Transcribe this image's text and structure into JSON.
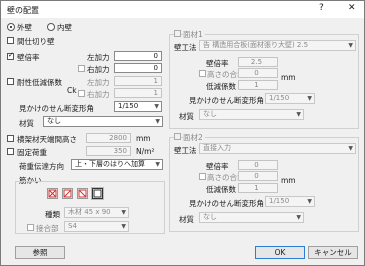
{
  "window": {
    "title": "壁の配置",
    "help": "?",
    "close": "✕"
  },
  "wall_side": {
    "outer": "外壁",
    "inner": "内壁",
    "selected": "outer"
  },
  "partition": {
    "label": "間仕切り壁",
    "checked": false
  },
  "wall_ratio": {
    "label": "壁倍率",
    "checked": true,
    "left_label": "左加力",
    "left_value": "0",
    "right_label": "右加力",
    "right_value": "0",
    "right_checked": false
  },
  "reduction": {
    "label": "耐性低減係数",
    "sub": "Ck",
    "checked": false,
    "left_label": "左加力",
    "left_value": "1",
    "right_label": "右加力",
    "right_value": "1",
    "right_checked": false
  },
  "apparent_shear": {
    "label": "見かけのせん断変形角",
    "value": "1/150"
  },
  "material": {
    "label": "材質",
    "value": "なし"
  },
  "ceiling_height": {
    "label": "横架材天端間高さ",
    "value": "2800",
    "unit": "mm",
    "checked": false
  },
  "fixed_load": {
    "label": "固定荷重",
    "value": "350",
    "unit": "N/m²",
    "checked": false
  },
  "load_direction": {
    "label": "荷重伝達方向",
    "value": "上・下層のはりへ加算"
  },
  "brace": {
    "label": "筋かい",
    "type_label": "種類",
    "type_value": "木材 45 x 90",
    "joint_label": "接合部",
    "joint_value": "S4",
    "joint_checked": false
  },
  "face1": {
    "label": "面材1",
    "checked": false,
    "method_label": "壁工法",
    "method_value": "告 構造用合板(面材張り大壁) 2.5",
    "ratio_label": "壁倍率",
    "ratio_value": "2.5",
    "total_label": "高さの合計",
    "total_value": "0",
    "unit": "mm",
    "total_checked": false,
    "reduce_label": "低減係数",
    "reduce_value": "1",
    "shear_label": "見かけのせん断変形角",
    "shear_value": "1/150",
    "material_label": "材質",
    "material_value": "なし"
  },
  "face2": {
    "label": "面材2",
    "checked": false,
    "method_label": "壁工法",
    "method_value": "直接入力",
    "ratio_label": "壁倍率",
    "ratio_value": "0",
    "total_label": "高さの合計",
    "total_value": "0",
    "unit": "mm",
    "total_checked": false,
    "reduce_label": "低減係数",
    "reduce_value": "1",
    "shear_label": "見かけのせん断変形角",
    "shear_value": "1/150",
    "material_label": "材質",
    "material_value": "なし"
  },
  "buttons": {
    "reference": "参照",
    "ok": "OK",
    "cancel": "キャンセル"
  }
}
